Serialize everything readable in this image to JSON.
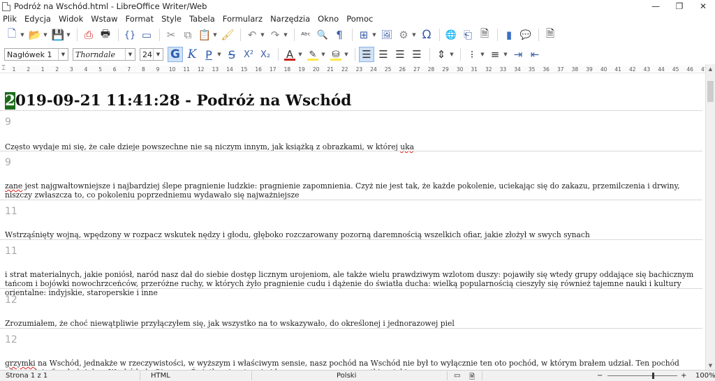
{
  "window": {
    "title": "Podróż na Wschód.html - LibreOffice Writer/Web",
    "minimize": "—",
    "maximize": "❐",
    "close": "✕"
  },
  "menu": [
    "Plik",
    "Edycja",
    "Widok",
    "Wstaw",
    "Format",
    "Style",
    "Tabela",
    "Formularz",
    "Narzędzia",
    "Okno",
    "Pomoc"
  ],
  "toolbar2": {
    "paragraph_style": "Nagłówek 1",
    "font_name": "Thorndale",
    "font_size": "24",
    "bold": "G",
    "italic": "K",
    "underline": "P",
    "strike": "S",
    "superscript": "X²",
    "subscript": "X₂",
    "font_color_glyph": "A",
    "font_color": "#c9211e",
    "highlight_color": "#ffe94a"
  },
  "icons": {
    "new": "🗋",
    "open": "📂",
    "save": "💾",
    "export_pdf": "⎙",
    "print": "🖶",
    "toggle_edit": "{}",
    "cut": "✂",
    "copy": "⧉",
    "paste": "📋",
    "clone": "🖌",
    "undo": "↶",
    "redo": "↷",
    "spell": "ᴬᵇᶜ",
    "find": "🔍",
    "formatting_marks": "¶",
    "table": "⊞",
    "image": "🖼",
    "chart": "⚙",
    "special_char": "Ω",
    "hyperlink": "🌐",
    "footnote": "⎗",
    "comment": "💬",
    "header": "▭",
    "bars": "▮",
    "page": "🗎"
  },
  "ruler": {
    "x_mark": "⌶",
    "ticks": [
      "1",
      "2",
      "1",
      "2",
      "3",
      "4",
      "5",
      "6",
      "7",
      "8",
      "9",
      "10",
      "11",
      "12",
      "13",
      "14",
      "15",
      "16",
      "17",
      "18",
      "19",
      "20",
      "21",
      "22",
      "23",
      "24",
      "25",
      "26",
      "27",
      "28",
      "29",
      "30",
      "31",
      "32",
      "33",
      "34",
      "35",
      "36",
      "37",
      "38",
      "39",
      "40",
      "41",
      "42",
      "43",
      "44",
      "45",
      "46",
      "47",
      "48",
      "49"
    ]
  },
  "document": {
    "heading_first_char": "2",
    "heading_rest": "019-09-21 11:41:28 - Podróż na Wschód",
    "entries": [
      {
        "num": "9",
        "pre": "Często wydaje mi się, że całe dzieje powszechne nie są niczym innym, jak książką z obrazkami, w której ",
        "err": "uka",
        "post": ""
      },
      {
        "num": "9",
        "pre": "",
        "err": "zane",
        "post": " jest najgwałtowniejsze i najbardziej ślepe pragnienie ludzkie: pragnienie zapomnienia. Czyż nie jest tak, że każde pokolenie, uciekając się do zakazu, przemilczenia i drwiny, niszczy zwłaszcza to, co pokoleniu poprzedniemu wydawało się najważniejsze"
      },
      {
        "num": "11",
        "pre": "Wstrząśnięty wojną, wpędzony w rozpacz wskutek nędzy i głodu, głęboko rozczarowany pozorną daremnością wszelkich ofiar, jakie złożył w swych synach",
        "err": "",
        "post": ""
      },
      {
        "num": "11",
        "pre": "i strat materialnych, jakie poniósł, naród nasz dał do siebie dostęp licznym urojeniom, ale także wielu prawdziwym wzlotom duszy: pojawiły się wtedy grupy oddające się bachicznym tańcom i bojówki nowochrzceńców, przeróżne ruchy, w których żyło pragnienie cudu i dążenie do światła ducha: wielką popularnością cieszyły się również tajemne nauki i kultury orientalne: indyjskie, staroperskie i inne",
        "err": "",
        "post": ""
      },
      {
        "num": "12",
        "pre": "Zrozumiałem, że choć niewątpliwie przyłączyłem się, jak wszystko na to wskazywało, do określonej i jednorazowej piel",
        "err": "",
        "post": ""
      },
      {
        "num": "12",
        "pre": "",
        "err": "grzymki",
        "post": " na Wschód, jednakże w rzeczywistości, w wyższym i właściwym sensie, nasz pochód na Wschód nie był to wyłącznie ten oto pochód, w którym brałem udział. Ten pochód wiernych i ufnych dążył na Wschód, do Ojczyzny Światła, nieustannie i bez przerwy, przez wszystkie wieki"
      }
    ]
  },
  "statusbar": {
    "page": "Strona 1 z 1",
    "mode": "HTML",
    "language": "Polski",
    "zoom_minus": "−",
    "zoom_plus": "+",
    "zoom": "100%"
  }
}
